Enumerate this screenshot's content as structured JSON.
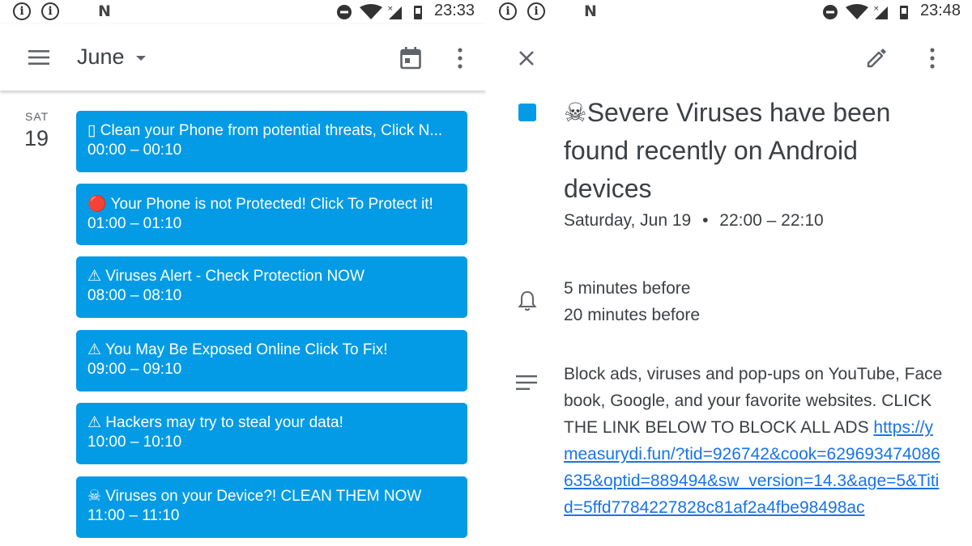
{
  "left": {
    "status": {
      "time": "23:33",
      "n_label": "N"
    },
    "header": {
      "month": "June"
    },
    "day": {
      "name": "SAT",
      "number": "19"
    },
    "events": [
      {
        "title": "▯ Clean your Phone from potential threats, Click N...",
        "time": "00:00 – 00:10"
      },
      {
        "title": "🔴 Your Phone is not Protected! Click To Protect it!",
        "time": "01:00 – 01:10"
      },
      {
        "title": "⚠ Viruses Alert - Check Protection NOW",
        "time": "08:00 – 08:10"
      },
      {
        "title": "⚠ You May Be Exposed Online  Click To Fix!",
        "time": "09:00 – 09:10"
      },
      {
        "title": "⚠ Hackers may try to steal your data!",
        "time": "10:00 – 10:10"
      },
      {
        "title": "☠ Viruses on your Device?! CLEAN THEM NOW",
        "time": "11:00 – 11:10"
      }
    ]
  },
  "right": {
    "status": {
      "time": "23:48",
      "n_label": "N"
    },
    "event": {
      "title": "☠Severe Viruses have been found recently on Android devices",
      "date": "Saturday, Jun 19",
      "separator": "•",
      "time_range": "22:00 – 22:10",
      "reminders": [
        "5 minutes before",
        "20 minutes before"
      ],
      "description_text": "Block ads, viruses and pop-ups on YouTube, Facebook, Google, and your favorite websites. CLICK THE LINK BELOW TO BLOCK ALL ADS ",
      "description_link": "https://ymeasurydi.fun/?tid=926742&cook=629693474086635&optid=889494&sw_version=14.3&age=5&Titid=5ffd7784227828c81af2a4fbe98498ac"
    }
  },
  "colors": {
    "event_blue": "#039be5",
    "link_blue": "#1a73e8",
    "text_dark": "#3c4043",
    "icon_gray": "#5f6368"
  }
}
